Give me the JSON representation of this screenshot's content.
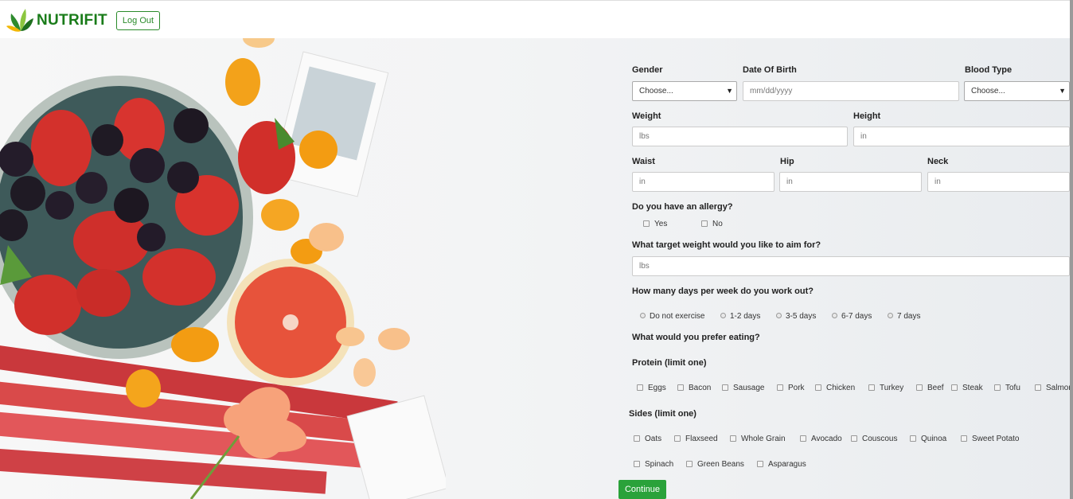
{
  "brand": {
    "name": "NUTRIFIT",
    "logout_label": "Log Out"
  },
  "form": {
    "gender": {
      "label": "Gender",
      "value": "Choose..."
    },
    "dob": {
      "label": "Date Of Birth",
      "placeholder": "mm/dd/yyyy"
    },
    "blood_type": {
      "label": "Blood Type",
      "value": "Choose..."
    },
    "weight": {
      "label": "Weight",
      "placeholder": "lbs"
    },
    "height": {
      "label": "Height",
      "placeholder": "in"
    },
    "waist": {
      "label": "Waist",
      "placeholder": "in"
    },
    "hip": {
      "label": "Hip",
      "placeholder": "in"
    },
    "neck": {
      "label": "Neck",
      "placeholder": "in"
    },
    "allergy": {
      "question": "Do you have an allergy?",
      "options": [
        "Yes",
        "No"
      ]
    },
    "target_weight": {
      "question": "What target weight would you like to aim for?",
      "placeholder": "lbs"
    },
    "workout": {
      "question": "How many days per week do you work out?",
      "options": [
        "Do not exercise",
        "1-2 days",
        "3-5 days",
        "6-7 days",
        "7 days"
      ]
    },
    "preference": {
      "question": "What would you prefer eating?"
    },
    "protein": {
      "label": "Protein (limit one)",
      "options": [
        "Eggs",
        "Bacon",
        "Sausage",
        "Pork",
        "Chicken",
        "Turkey",
        "Beef",
        "Steak",
        "Tofu",
        "Salmon"
      ]
    },
    "sides": {
      "label": "Sides (limit one)",
      "options": [
        "Oats",
        "Flaxseed",
        "Whole Grain",
        "Avocado",
        "Couscous",
        "Quinoa",
        "Sweet Potato",
        "Spinach",
        "Green Beans",
        "Asparagus"
      ]
    },
    "continue_label": "Continue"
  }
}
